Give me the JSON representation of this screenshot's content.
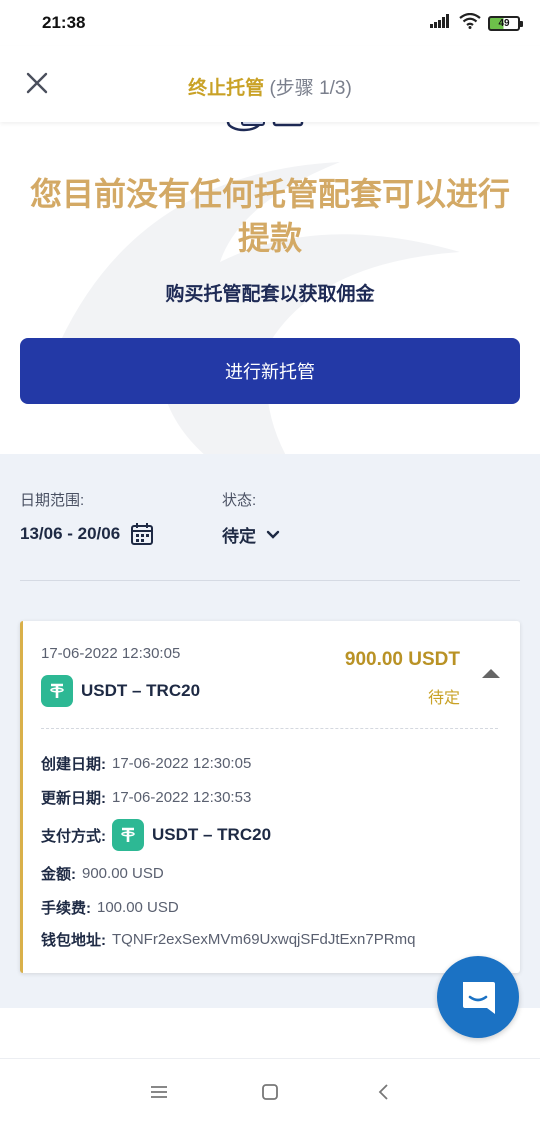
{
  "status_bar": {
    "time": "21:38",
    "battery_level": "49",
    "icons": [
      "signal-icon",
      "wifi-icon",
      "battery-icon"
    ]
  },
  "header": {
    "title": "终止托管",
    "step": "(步骤 1/3)"
  },
  "hero": {
    "title": "您目前没有任何托管配套可以进行提款",
    "subtitle": "购买托管配套以获取佣金",
    "button_label": "进行新托管"
  },
  "filters": {
    "date_label": "日期范围:",
    "date_value": "13/06 - 20/06",
    "status_label": "状态:",
    "status_value": "待定"
  },
  "transaction": {
    "datetime": "17-06-2022 12:30:05",
    "amount": "900.00 USDT",
    "status": "待定",
    "coin": "USDT – TRC20",
    "details": {
      "created_label": "创建日期:",
      "created_value": "17-06-2022 12:30:05",
      "updated_label": "更新日期:",
      "updated_value": "17-06-2022 12:30:53",
      "payment_label": "支付方式:",
      "payment_value": "USDT – TRC20",
      "amount_label": "金额:",
      "amount_value": "900.00 USD",
      "fee_label": "手续费:",
      "fee_value": "100.00 USD",
      "wallet_label": "钱包地址:",
      "wallet_value": "TQNFr2exSexMVm69UxwqjSFdJtExn7PRmq"
    }
  },
  "colors": {
    "accent_gold": "#c9a227",
    "primary_blue": "#2339a6",
    "tether_green": "#2db894",
    "chat_blue": "#1b72c4",
    "section_bg": "#eef2f8"
  }
}
